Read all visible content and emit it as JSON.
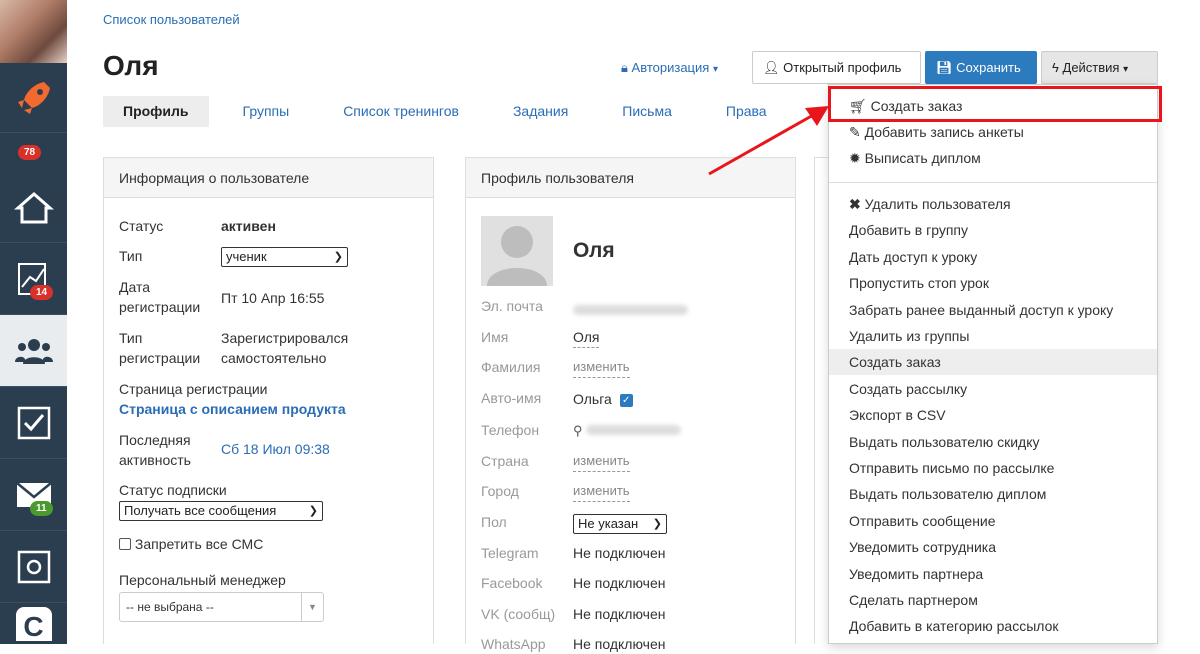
{
  "breadcrumb": "Список пользователей",
  "page_title": "Оля",
  "tabs": [
    "Профиль",
    "Группы",
    "Список тренингов",
    "Задания",
    "Письма",
    "Права"
  ],
  "header_buttons": {
    "auth": "Авторизация",
    "open_profile": "Открытый профиль",
    "save": "Сохранить",
    "actions": "Действия"
  },
  "sidebar": {
    "badge_notifications": "78",
    "badge_tasks": "14",
    "badge_mail": "11"
  },
  "info_panel": {
    "title": "Информация о пользователе",
    "status_label": "Статус",
    "status_value": "активен",
    "type_label": "Тип",
    "type_value": "ученик",
    "reg_date_label_1": "Дата",
    "reg_date_label_2": "регистрации",
    "reg_date_value": "Пт 10 Апр 16:55",
    "reg_type_label_1": "Тип",
    "reg_type_label_2": "регистрации",
    "reg_type_value_1": "Зарегистрировался",
    "reg_type_value_2": "самостоятельно",
    "reg_page_label": "Страница регистрации",
    "reg_page_value": "Страница с описанием продукта",
    "last_activity_label_1": "Последняя",
    "last_activity_label_2": "активность",
    "last_activity_value": "Сб 18 Июл 09:38",
    "subscription_label": "Статус подписки",
    "subscription_value": "Получать все сообщения",
    "sms_label": "Запретить все СМС",
    "manager_label": "Персональный менеджер",
    "manager_value": "-- не выбрана --"
  },
  "profile_panel": {
    "title": "Профиль пользователя",
    "name_display": "Оля",
    "email_label": "Эл. почта",
    "first_name_label": "Имя",
    "first_name_value": "Оля",
    "last_name_label": "Фамилия",
    "change": "изменить",
    "auto_name_label": "Авто-имя",
    "auto_name_value": "Ольга",
    "phone_label": "Телефон",
    "country_label": "Страна",
    "city_label": "Город",
    "gender_label": "Пол",
    "gender_value": "Не указан",
    "telegram_label": "Telegram",
    "facebook_label": "Facebook",
    "vk_label": "VK (сообщ)",
    "whatsapp_label": "WhatsApp",
    "not_connected": "Не подключен"
  },
  "actions_menu": {
    "top": [
      "Создать заказ",
      "Добавить запись анкеты",
      "Выписать диплом"
    ],
    "bottom": [
      "Удалить пользователя",
      "Добавить в группу",
      "Дать доступ к уроку",
      "Пропустить стоп урок",
      "Забрать ранее выданный доступ к уроку",
      "Удалить из группы",
      "Создать заказ",
      "Создать рассылку",
      "Экспорт в CSV",
      "Выдать пользователю скидку",
      "Отправить письмо по рассылке",
      "Выдать пользователю диплом",
      "Отправить сообщение",
      "Уведомить сотрудника",
      "Уведомить партнера",
      "Сделать партнером",
      "Добавить в категорию рассылок"
    ]
  },
  "colors": {
    "sidebar": "#2b3e50",
    "link": "#2a6db5",
    "save": "#2d7bbf",
    "highlight": "#e8161b",
    "badge_red": "#d9312a",
    "badge_green": "#4a9a2e"
  }
}
